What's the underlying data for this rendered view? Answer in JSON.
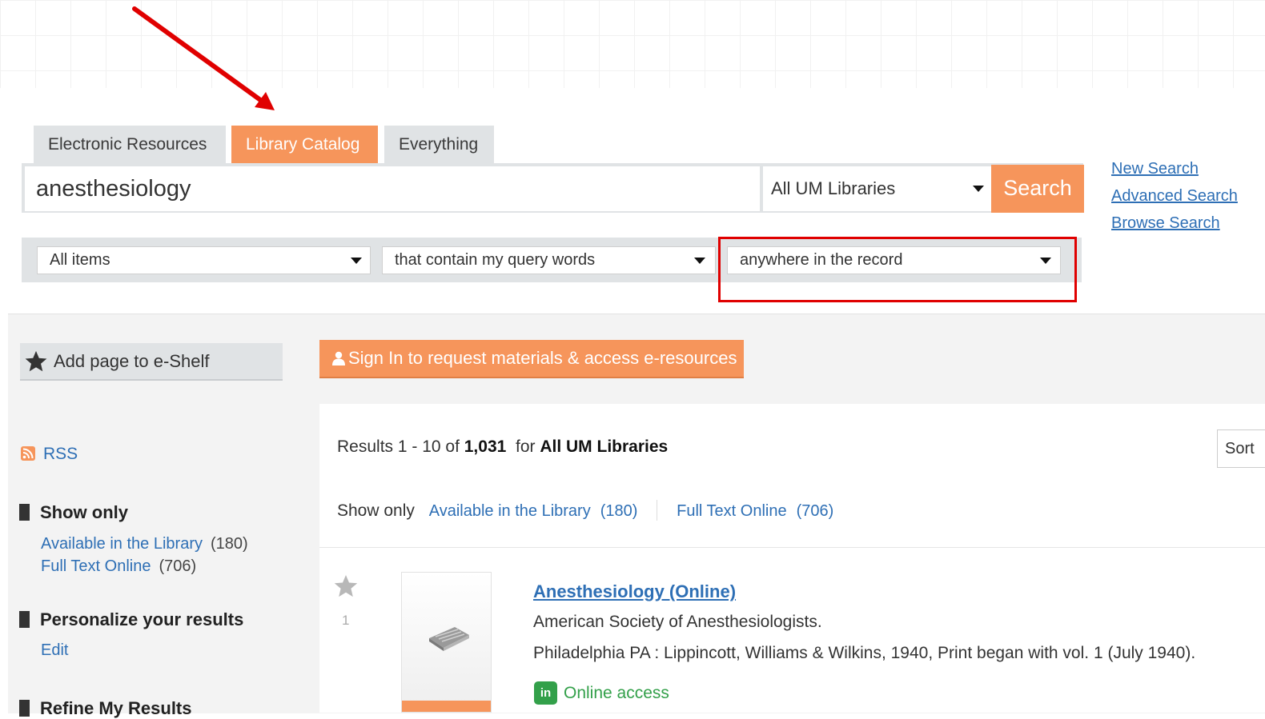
{
  "tabs": [
    {
      "label": "Electronic Resources",
      "active": false
    },
    {
      "label": "Library Catalog",
      "active": true
    },
    {
      "label": "Everything",
      "active": false
    }
  ],
  "search": {
    "query": "anesthesiology",
    "scope": "All UM Libraries",
    "button": "Search"
  },
  "side_links": {
    "new_search": "New Search",
    "advanced_search": "Advanced Search",
    "browse_search": "Browse Search"
  },
  "filters": {
    "material": "All items",
    "precision": "that contain my query words",
    "field": "anywhere in the record"
  },
  "actions": {
    "eshelf": "Add page to e-Shelf",
    "signin": "Sign In to request materials & access e-resources"
  },
  "sidebar": {
    "rss": "RSS",
    "show_only_heading": "Show only",
    "show_only": [
      {
        "label": "Available in the Library",
        "count": "(180)"
      },
      {
        "label": "Full Text Online",
        "count": "(706)"
      }
    ],
    "personalize_heading": "Personalize your results",
    "personalize_edit": "Edit",
    "refine_heading": "Refine My Results"
  },
  "results": {
    "prefix": "Results 1 - 10 of",
    "total": "1,031",
    "for_text": "for",
    "scope": "All UM Libraries",
    "sort_label": "Sort",
    "show_only_label": "Show only",
    "show_only": [
      {
        "label": "Available in the Library",
        "count": "(180)"
      },
      {
        "label": "Full Text Online",
        "count": "(706)"
      }
    ]
  },
  "record": {
    "number": "1",
    "title": "Anesthesiology (Online)",
    "author": "American Society of Anesthesiologists.",
    "publication": "Philadelphia PA : Lippincott, Williams & Wilkins, 1940, Print began with vol. 1 (July 1940).",
    "access_icon_text": "in",
    "access": "Online access"
  },
  "colors": {
    "accent": "#f6955b",
    "link": "#2e6fb5",
    "highlight": "#e00000",
    "online": "#33a04a"
  },
  "icons": [
    "arrow-annotation-icon",
    "star-icon",
    "person-icon",
    "rss-icon",
    "book-icon",
    "online-access-icon",
    "chevron-down-icon"
  ]
}
